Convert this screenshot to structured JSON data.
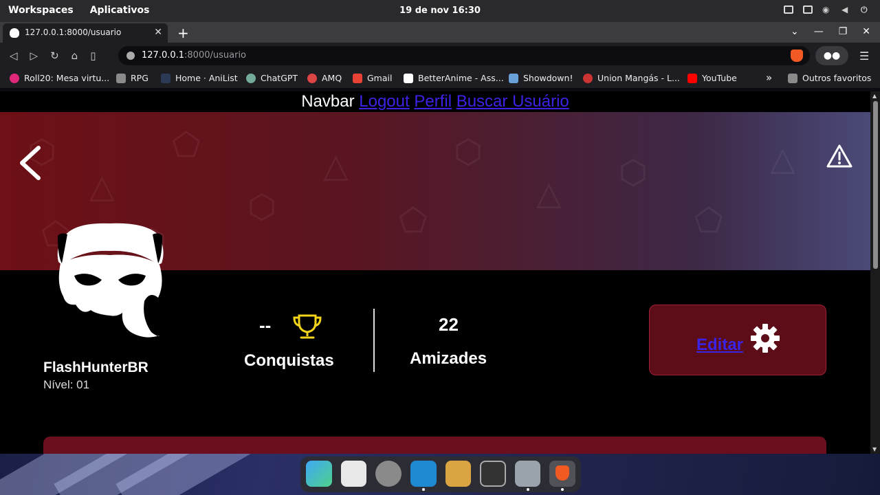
{
  "system": {
    "workspaces": "Workspaces",
    "apps": "Aplicativos",
    "datetime": "19 de nov  16:30"
  },
  "browser": {
    "tab_title": "127.0.0.1:8000/usuario",
    "url_host": "127.0.0.1",
    "url_path": ":8000/usuario",
    "bookmarks": [
      {
        "label": "Roll20: Mesa virtu...",
        "color": "#e0287a"
      },
      {
        "label": "RPG",
        "color": "#8a8a8a"
      },
      {
        "label": "Home · AniList",
        "color": "#1e1d22"
      },
      {
        "label": "ChatGPT",
        "color": "#74aa9c"
      },
      {
        "label": "AMQ",
        "color": "#d44"
      },
      {
        "label": "Gmail",
        "color": "#ea4335"
      },
      {
        "label": "BetterAnime - Ass...",
        "color": "#ffffff"
      },
      {
        "label": "Showdown!",
        "color": "#6aa0d8"
      },
      {
        "label": "Union Mangás - L...",
        "color": "#c33"
      },
      {
        "label": "YouTube",
        "color": "#ff0000"
      }
    ],
    "more_bookmarks": "»",
    "other_favorites": "Outros favoritos"
  },
  "page": {
    "navbar_text": "Navbar",
    "nav_links": [
      "Logout",
      "Perfil",
      "Buscar Usuário"
    ],
    "username": "FlashHunterBR",
    "level": "Nível: 01",
    "achievements_value": "--",
    "achievements_label": "Conquistas",
    "friends_value": "22",
    "friends_label": "Amizades",
    "edit_label": "Editar"
  },
  "colors": {
    "link": "#3b23e6",
    "edit_box": "#5d0d18",
    "trophy": "#f2d41a",
    "bottom_card": "#6b0f1f"
  }
}
